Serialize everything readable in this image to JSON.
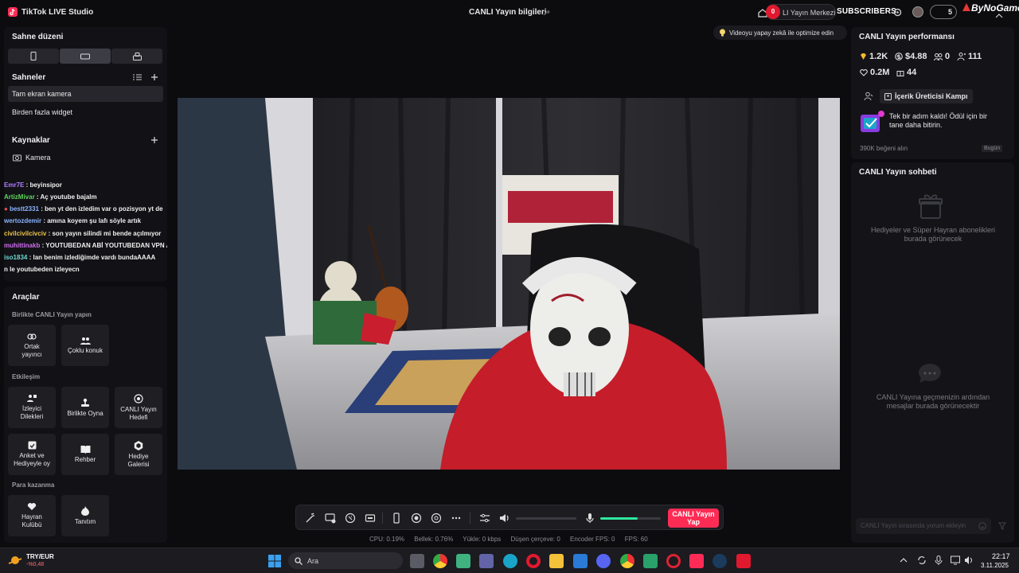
{
  "app": {
    "title": "TikTok LIVE Studio",
    "center_title": "CANLI Yayın bilgileri",
    "live_center": "LI Yayın Merkezi",
    "notif_count": "0",
    "subscribers_label": "SUBSCRIBERS",
    "sub_count": "5",
    "brand": "ByNoGame"
  },
  "left": {
    "layout_title": "Sahne düzeni",
    "scenes_title": "Sahneler",
    "scenes": [
      "Tam ekran kamera",
      "Birden fazla widget"
    ],
    "sources_title": "Kaynaklar",
    "sources": [
      "Kamera"
    ],
    "chat": [
      {
        "user": "Emr7E",
        "msg": " : beyinsipor",
        "color": "#b07cff"
      },
      {
        "user": "ArtizMivar",
        "msg": " : Aç youtube bajalm",
        "color": "#5fd35f"
      },
      {
        "user": "bestt2331",
        "msg": " : ben yt den izledim var o pozisyon yt de",
        "color": "#8ab4ff"
      },
      {
        "user": "wertozdemir",
        "msg": " : amına koyem şu lafı söyle artık",
        "color": "#8ab4ff"
      },
      {
        "user": "civilcivilcivciv",
        "msg": " : son yayın silindi mi bende açılmıyor",
        "color": "#e9c34a"
      },
      {
        "user": "muhittinakb",
        "msg": " : YOUTUBEDAN ABİ YOUTUBEDAN VPN AÇ",
        "color": "#d06cf0"
      },
      {
        "user": "iso1834",
        "msg": " : lan benim izlediğimde vardı bundaAAAA",
        "color": "#6fd6d0"
      },
      {
        "user": "",
        "msg": "n le youtubeden izleyecn",
        "color": "#ffffff"
      }
    ],
    "tools_title": "Araçlar",
    "sections": {
      "collab": "Birlikte CANLI Yayın yapın",
      "interaction": "Etkileşim",
      "money": "Para kazanma"
    },
    "tools": {
      "cohost": "Ortak yayıncı",
      "multiguest": "Çoklu konuk",
      "requests": "İzleyici Dilekleri",
      "play": "Birlikte Oyna",
      "goal": "CANLI Yayın Hedefi",
      "poll": "Anket ve Hediyeyle oy",
      "guide": "Rehber",
      "gallery": "Hediye Galerisi",
      "fanclub": "Hayran Kulübü",
      "promo": "Tanıtım"
    }
  },
  "center": {
    "ai_hint": "Videoyu yapay zekâ ile optimize edin",
    "go_live": "CANLI Yayın Yap",
    "volume_level": 0.0,
    "mic_level": 0.62,
    "stats": {
      "cpu": "CPU:  0.19%",
      "mem": "Bellek:  0.76%",
      "upload": "Yükle:  0 kbps",
      "dropped": "Düşen çerçeve:  0",
      "encoder": "Encoder FPS:  0",
      "fps": "FPS:  60"
    }
  },
  "right": {
    "perf_title": "CANLI Yayın performansı",
    "stats": {
      "diamonds": "1.2K",
      "dollars": "$4.88",
      "viewers": "0",
      "followers": "111",
      "likes": "0.2M",
      "gifts": "44"
    },
    "camp_label": "İçerik Üreticisi Kampı",
    "camp_msg": "Tek bir adım kaldı! Ödül için bir tane daha bitirin.",
    "likes_progress": "390K beğeni alın",
    "likes_badge": "Bugün",
    "chat_title": "CANLI Yayın sohbeti",
    "gifts_empty": "Hediyeler ve Süper Hayran abonelikleri burada görünecek",
    "chat_empty": "CANLI Yayına geçmenizin ardından mesajlar burada görünecektir",
    "chat_placeholder": "CANLI Yayın sırasında yorum ekleyin"
  },
  "taskbar": {
    "weather_pair": "TRY/EUR",
    "weather_change": "-%0,48",
    "search_placeholder": "Ara",
    "time": "22:17",
    "date": "3.11.2025"
  },
  "colors": {
    "accent": "#fe2c55",
    "mic": "#2ee89e"
  }
}
